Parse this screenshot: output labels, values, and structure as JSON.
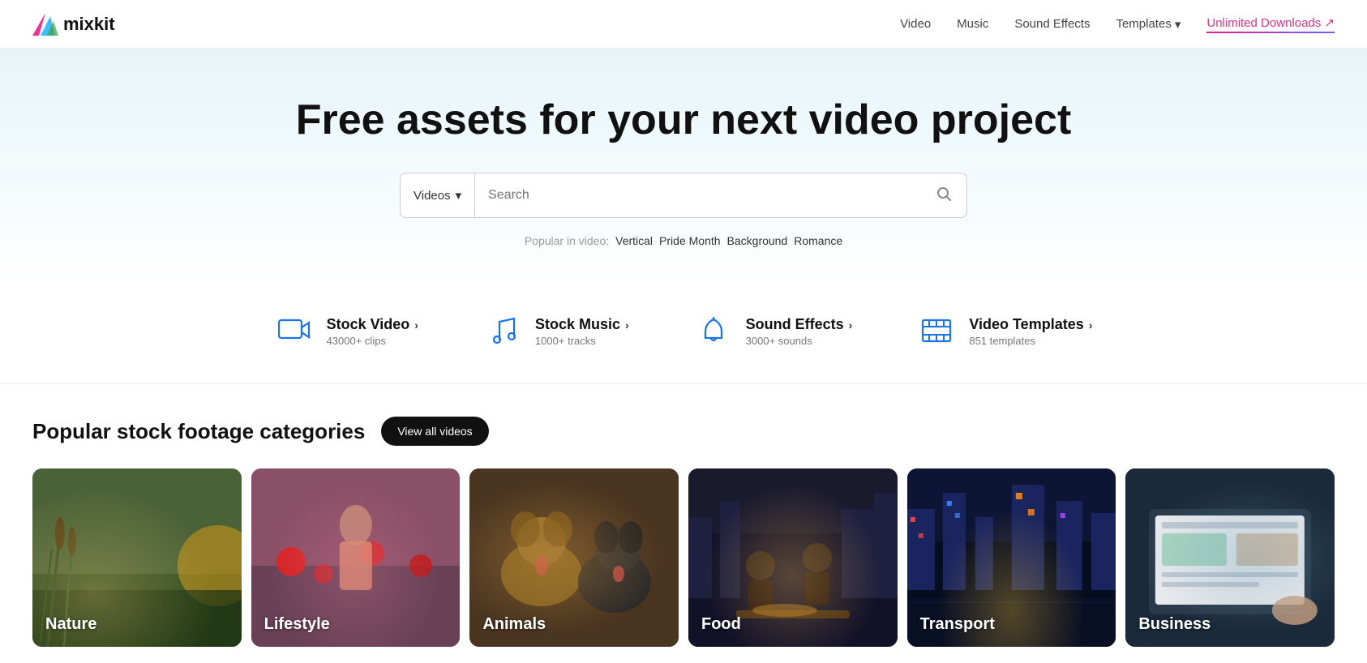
{
  "navbar": {
    "logo_text": "mixkit",
    "links": [
      {
        "id": "video",
        "label": "Video"
      },
      {
        "id": "music",
        "label": "Music"
      },
      {
        "id": "sound-effects",
        "label": "Sound Effects"
      },
      {
        "id": "templates",
        "label": "Templates",
        "has_dropdown": true
      },
      {
        "id": "unlimited",
        "label": "Unlimited Downloads ↗",
        "is_cta": true
      }
    ]
  },
  "hero": {
    "title": "Free assets for your next video project",
    "search": {
      "type_label": "Videos",
      "placeholder": "Search",
      "dropdown_icon": "▾"
    },
    "popular": {
      "label": "Popular in video:",
      "tags": [
        "Vertical",
        "Pride Month",
        "Background",
        "Romance"
      ]
    }
  },
  "section_links": [
    {
      "id": "stock-video",
      "icon": "🎬",
      "title": "Stock Video",
      "subtitle": "43000+ clips"
    },
    {
      "id": "stock-music",
      "icon": "🎵",
      "title": "Stock Music",
      "subtitle": "1000+ tracks"
    },
    {
      "id": "sound-effects",
      "icon": "🔔",
      "title": "Sound Effects",
      "subtitle": "3000+ sounds"
    },
    {
      "id": "video-templates",
      "icon": "🎞",
      "title": "Video Templates",
      "subtitle": "851 templates"
    }
  ],
  "categories": {
    "section_title": "Popular stock footage categories",
    "view_all_label": "View all videos",
    "items": [
      {
        "id": "nature",
        "label": "Nature",
        "color_class": "cat-nature"
      },
      {
        "id": "lifestyle",
        "label": "Lifestyle",
        "color_class": "cat-lifestyle"
      },
      {
        "id": "animals",
        "label": "Animals",
        "color_class": "cat-animals"
      },
      {
        "id": "food",
        "label": "Food",
        "color_class": "cat-food"
      },
      {
        "id": "transport",
        "label": "Transport",
        "color_class": "cat-transport"
      },
      {
        "id": "business",
        "label": "Business",
        "color_class": "cat-business"
      }
    ]
  }
}
